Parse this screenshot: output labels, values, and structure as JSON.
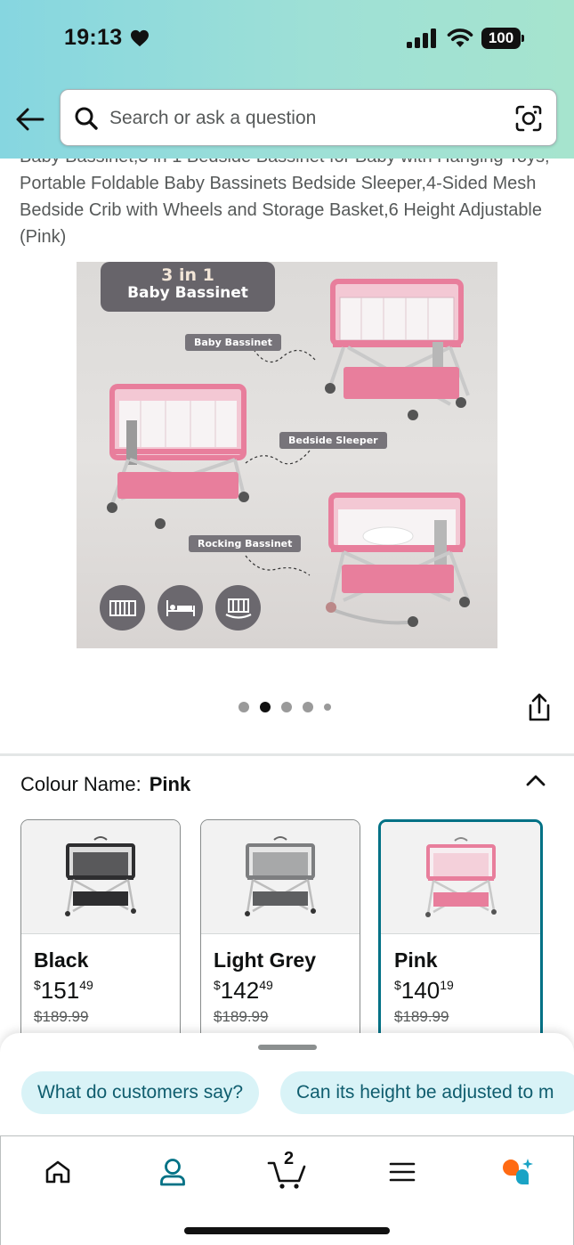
{
  "status_bar": {
    "time": "19:13",
    "battery": "100"
  },
  "search": {
    "placeholder": "Search or ask a question"
  },
  "product": {
    "title": "Baby Bassinet,3 in 1 Bedside Bassinet for Baby with Hanging Toys, Portable Foldable Baby Bassinets Bedside Sleeper,4-Sided Mesh Bedside Crib with Wheels and Storage Basket,6 Height Adjustable (Pink)"
  },
  "hero_image": {
    "badge_line1": "3 in 1",
    "badge_line2": "Baby Bassinet",
    "labels": [
      "Baby Bassinet",
      "Bedside Sleeper",
      "Rocking Bassinet"
    ],
    "mode_icons": [
      "crib-icon",
      "bed-icon",
      "rocker-icon"
    ],
    "image_count": 5,
    "current_image": 2
  },
  "colour": {
    "label": "Colour Name:",
    "selected": "Pink",
    "options": [
      {
        "name": "Black",
        "currency": "$",
        "whole": "151",
        "fraction": "49",
        "list_price": "$189.99",
        "color": "#2e2e30"
      },
      {
        "name": "Light Grey",
        "currency": "$",
        "whole": "142",
        "fraction": "49",
        "list_price": "$189.99",
        "color": "#7d7e80"
      },
      {
        "name": "Pink",
        "currency": "$",
        "whole": "140",
        "fraction": "19",
        "list_price": "$189.99",
        "color": "#e87e9c"
      }
    ]
  },
  "suggestions": [
    "What do customers say?",
    "Can its height be adjusted to m"
  ],
  "nav": {
    "cart_count": "2",
    "items": [
      "home-icon",
      "account-icon",
      "cart-icon",
      "menu-icon",
      "rufus-icon"
    ]
  },
  "colors": {
    "accent": "#007185",
    "chip_bg": "#d9f3f7",
    "header_start": "#86d6e0",
    "header_end": "#a6e4ce",
    "bassinet_pink": "#e87e9c"
  }
}
